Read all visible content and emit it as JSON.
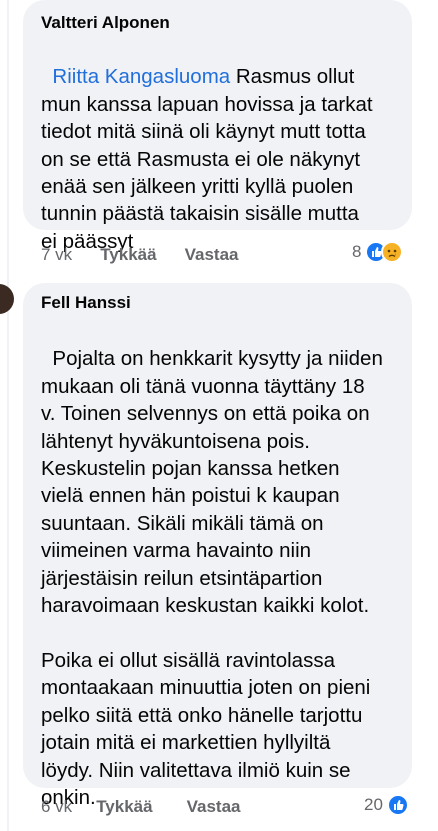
{
  "comments": [
    {
      "author": "Valtteri Alponen",
      "mention": "Riitta Kangasluoma",
      "lines": [
        " Rasmus ollut",
        "mun kanssa lapuan hovissa ja tarkat",
        "tiedot mitä siinä oli käynyt mutt totta",
        "on se että Rasmusta ei ole näkynyt",
        "enää sen jälkeen yritti kyllä puolen",
        "tunnin päästä takaisin sisälle mutta",
        "ei päässyt"
      ],
      "time": "7 vk",
      "like_label": "Tykkää",
      "reply_label": "Vastaa",
      "reaction_count": "8",
      "reactions": [
        "like-icon",
        "sad-icon"
      ]
    },
    {
      "author": "Fell Hanssi",
      "lines": [
        "Pojalta on henkkarit kysytty ja niiden",
        "mukaan oli tänä vuonna täyttäny 18",
        "v. Toinen selvennys on että poika on",
        "lähtenyt hyväkuntoisena pois.",
        "Keskustelin pojan kanssa hetken",
        "vielä ennen hän poistui k kaupan",
        "suuntaan. Sikäli mikäli tämä on",
        "viimeinen varma havainto niin",
        "järjestäisin reilun etsintäpartion",
        "haravoimaan keskustan kaikki kolot.",
        "",
        "Poika ei ollut sisällä ravintolassa",
        "montaakaan minuuttia joten on pieni",
        "pelko siitä että onko hänelle tarjottu",
        "jotain mitä ei markettien hyllyiltä",
        "löydy. Niin valitettava ilmiö kuin se",
        "onkin."
      ],
      "time": "6 vk",
      "like_label": "Tykkää",
      "reply_label": "Vastaa",
      "reaction_count": "20",
      "reactions": [
        "like-icon"
      ]
    }
  ]
}
